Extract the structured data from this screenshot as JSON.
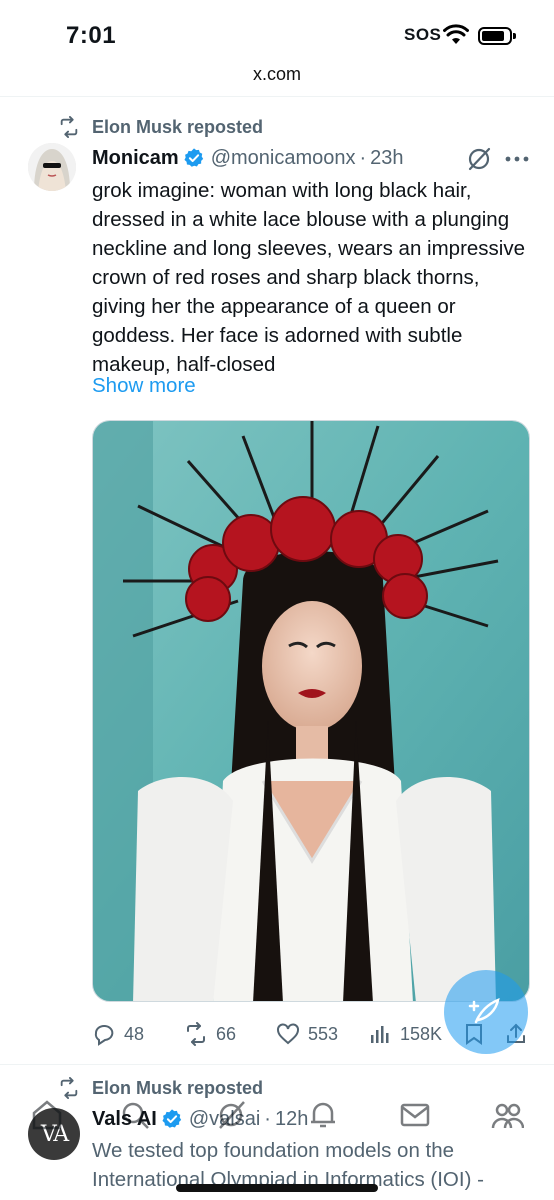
{
  "status_bar": {
    "time": "7:01",
    "sos": "SOS"
  },
  "browser": {
    "url": "x.com"
  },
  "tweets": [
    {
      "repost_label": "Elon Musk reposted",
      "display_name": "Monicam",
      "handle": "@monicamoonx",
      "separator": "·",
      "timestamp": "23h",
      "text": "grok imagine: woman with long black hair, dressed in a white lace blouse with a plunging neckline and long sleeves, wears an impressive crown of red roses and sharp black thorns, giving her the appearance of a queen or goddess. Her face is adorned with subtle makeup, half-closed",
      "show_more": "Show more",
      "stats": {
        "replies": "48",
        "reposts": "66",
        "likes": "553",
        "views": "158K"
      }
    },
    {
      "repost_label": "Elon Musk reposted",
      "display_name": "Vals AI",
      "handle": "@valsai",
      "separator": "·",
      "timestamp": "12h",
      "avatar_text": "VA",
      "text": "We tested top foundation models on the International Olympiad in Informatics (IOI) -"
    }
  ],
  "colors": {
    "accent": "#1d9bf0",
    "secondary_text": "#536471",
    "primary_text": "#0f1419"
  },
  "icons": [
    "repost-icon",
    "verified-icon",
    "grok-icon",
    "more-icon",
    "reply-icon",
    "like-icon",
    "views-icon",
    "bookmark-icon",
    "share-icon",
    "compose-icon",
    "home-icon",
    "search-icon",
    "notifications-icon",
    "messages-icon",
    "communities-icon"
  ]
}
